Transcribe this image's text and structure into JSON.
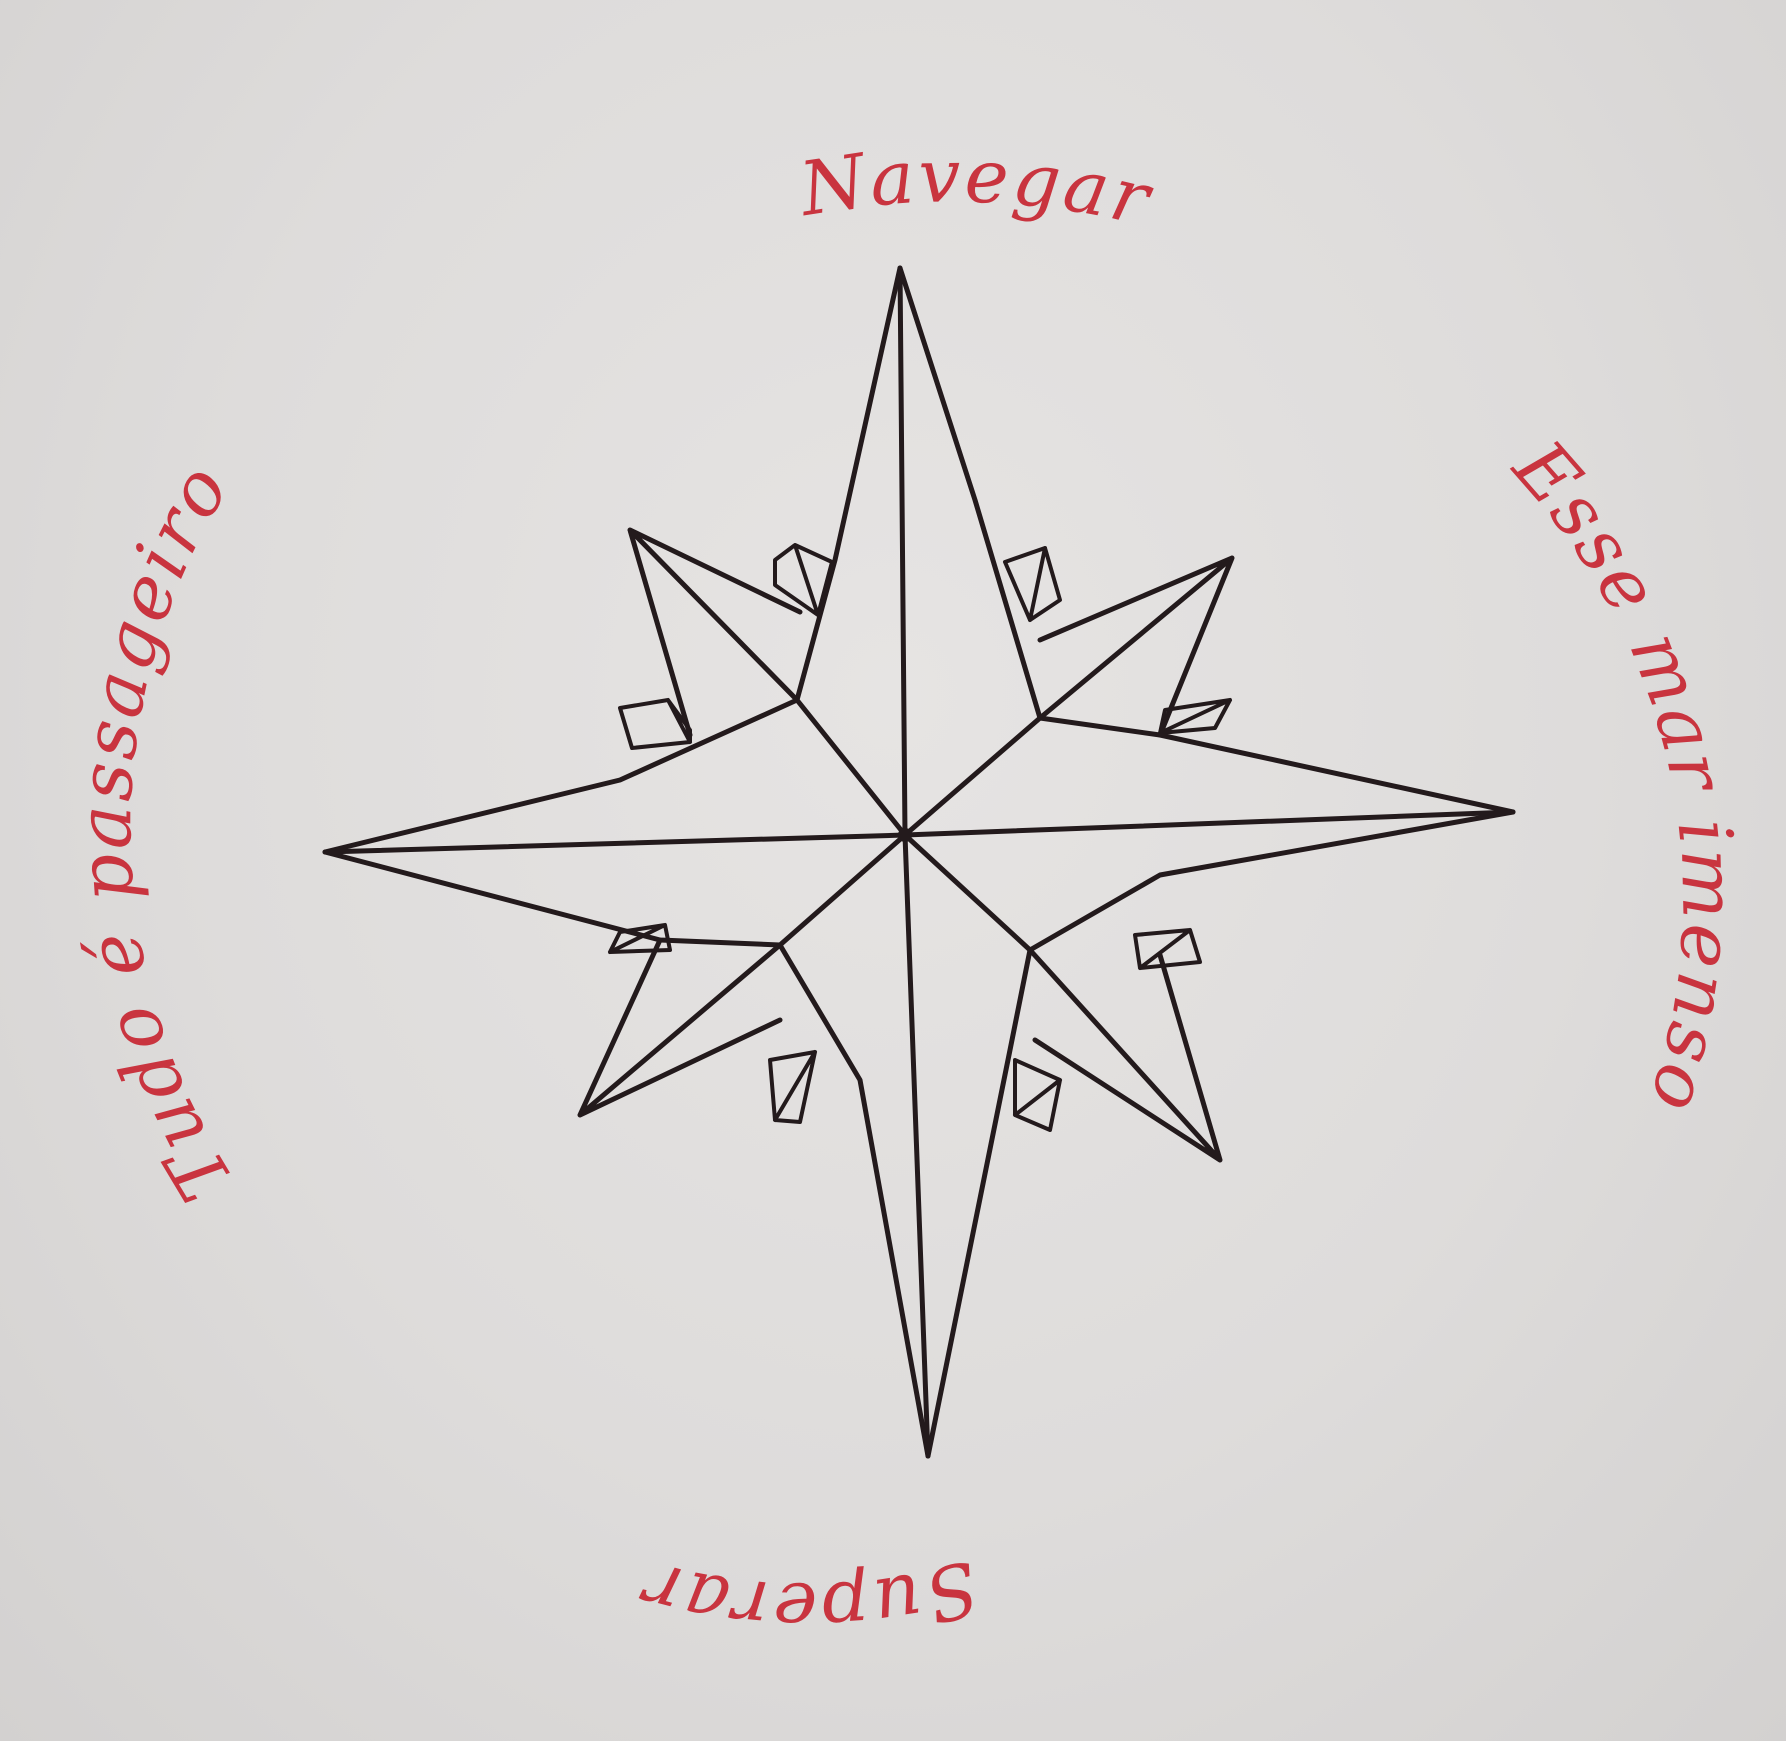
{
  "drawing": {
    "subject": "compass rose",
    "colors": {
      "paper": "#dcdad9",
      "ink_star": "#231a1c",
      "ink_text": "#c9343f"
    },
    "inscriptions": {
      "top": "Navegar",
      "right": "Esse mar imenso",
      "bottom": "Superar",
      "left": "Tudo é passageiro"
    }
  }
}
